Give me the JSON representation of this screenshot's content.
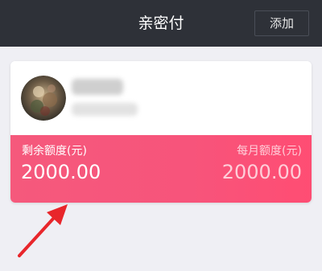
{
  "nav": {
    "title": "亲密付",
    "add_label": "添加"
  },
  "card": {
    "remaining_label": "剩余额度(元)",
    "remaining_value": "2000.00",
    "monthly_label": "每月额度(元)",
    "monthly_value": "2000.00"
  },
  "colors": {
    "nav_bg": "#2e3138",
    "card_accent": "#f7547b",
    "arrow": "#e8262b"
  }
}
